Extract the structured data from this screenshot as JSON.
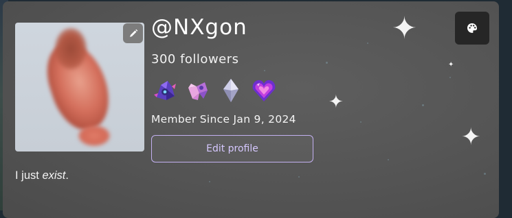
{
  "profile": {
    "username": "@NXgon",
    "followers": "300 followers",
    "member_since": "Member Since Jan 9, 2024",
    "edit_profile_label": "Edit profile",
    "bio_prefix": "I just ",
    "bio_emphasis": "exist",
    "bio_suffix": "."
  },
  "badges": [
    {
      "icon": "purple-creature-badge-icon"
    },
    {
      "icon": "pink-bird-badge-icon"
    },
    {
      "icon": "crystal-badge-icon"
    },
    {
      "icon": "purple-heart-gem-badge-icon"
    }
  ],
  "icons": {
    "avatar_edit": "pencil-icon",
    "theme": "palette-icon"
  },
  "colors": {
    "card_background": "#545454",
    "button_border": "#c4b1f2",
    "button_text": "#d6c8ff",
    "theme_button": "#262626"
  }
}
